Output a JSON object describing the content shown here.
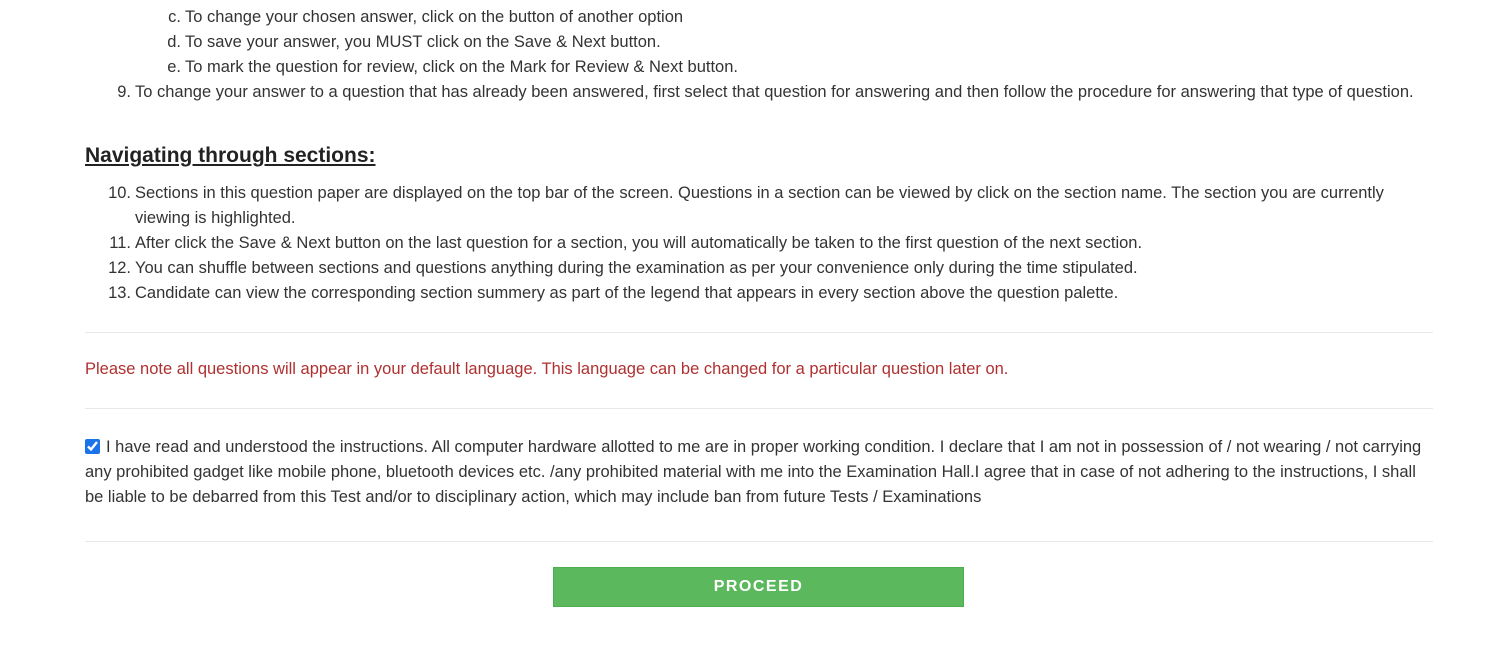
{
  "answer_steps": [
    {
      "marker": "c.",
      "text": "To change your chosen answer, click on the button of another option"
    },
    {
      "marker": "d.",
      "text": "To save your answer, you MUST click on the Save & Next button."
    },
    {
      "marker": "e.",
      "text": "To mark the question for review, click on the Mark for Review & Next button."
    }
  ],
  "item9": {
    "marker": "9.",
    "text": "To change your answer to a question that has already been answered, first select that question for answering and then follow the procedure for answering that type of question."
  },
  "sections_heading": "Navigating through sections:",
  "section_items": [
    {
      "marker": "10.",
      "text": "Sections in this question paper are displayed on the top bar of the screen. Questions in a section can be viewed by click on the section name. The section you are currently viewing is highlighted."
    },
    {
      "marker": "11.",
      "text": "After click the Save & Next button on the last question for a section, you will automatically be taken to the first question of the next section."
    },
    {
      "marker": "12.",
      "text": "You can shuffle between sections and questions anything during the examination as per your convenience only during the time stipulated."
    },
    {
      "marker": "13.",
      "text": "Candidate can view the corresponding section summery as part of the legend that appears in every section above the question palette."
    }
  ],
  "language_note": "Please note all questions will appear in your default language. This language can be changed for a particular question later on.",
  "declaration": {
    "checked": true,
    "text": "I have read and understood the instructions. All computer hardware allotted to me are in proper working condition. I declare that I am not in possession of / not wearing / not carrying any prohibited gadget like mobile phone, bluetooth devices etc. /any prohibited material with me into the Examination Hall.I agree that in case of not adhering to the instructions, I shall be liable to be debarred from this Test and/or to disciplinary action, which may include ban from future Tests / Examinations"
  },
  "proceed_label": "PROCEED",
  "colors": {
    "note": "#b03030",
    "proceed": "#5cb85c"
  }
}
